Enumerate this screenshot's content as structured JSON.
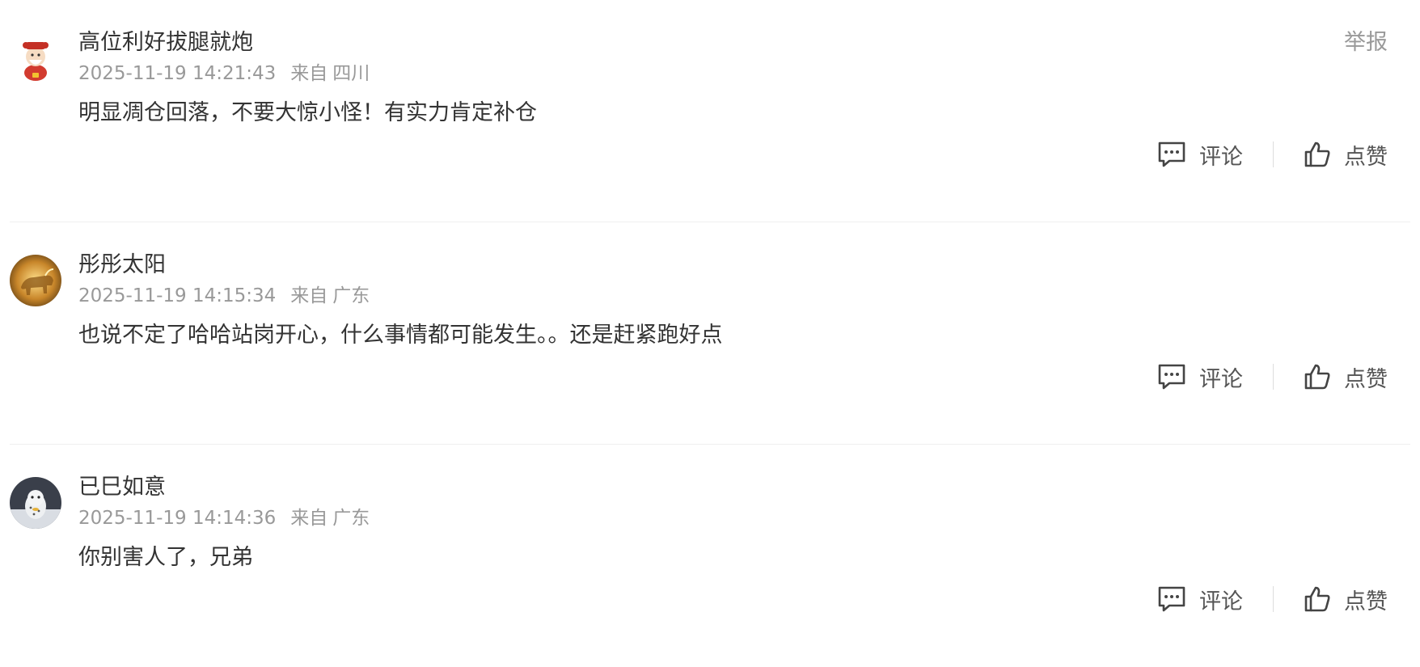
{
  "comments": [
    {
      "username": "高位利好拔腿就炮",
      "timestamp": "2025-11-19 14:21:43",
      "location_prefix": "来自",
      "location": "四川",
      "content": "明显凋仓回落，不要大惊小怪！有实力肯定补仓",
      "report_label": "举报",
      "reply_label": "评论",
      "like_label": "点赞",
      "avatar_icon": "cartoon-fortune-god-avatar"
    },
    {
      "username": "彤彤太阳",
      "timestamp": "2025-11-19 14:15:34",
      "location_prefix": "来自",
      "location": "广东",
      "content": "也说不定了哈哈站岗开心，什么事情都可能发生。。还是赶紧跑好点",
      "reply_label": "评论",
      "like_label": "点赞",
      "avatar_icon": "golden-bull-avatar"
    },
    {
      "username": "已巳如意",
      "timestamp": "2025-11-19 14:14:36",
      "location_prefix": "来自",
      "location": "广东",
      "content": "你别害人了，兄弟",
      "reply_label": "评论",
      "like_label": "点赞",
      "avatar_icon": "snow-leopard-avatar"
    }
  ],
  "colors": {
    "primary_text": "#333333",
    "secondary_text": "#999999",
    "action_text": "#555555",
    "divider": "#efefef"
  }
}
